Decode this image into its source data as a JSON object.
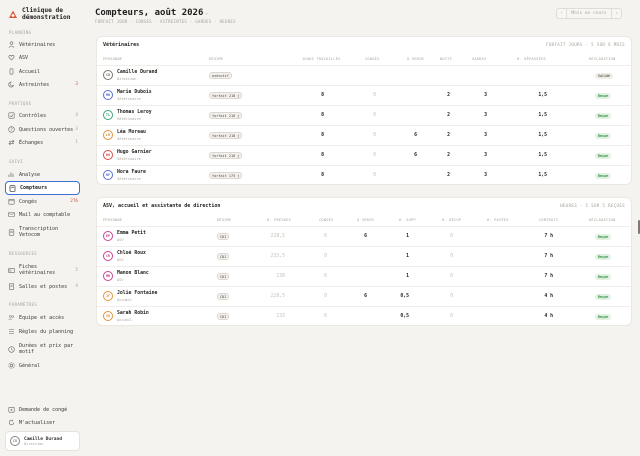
{
  "brand": {
    "name": "Clinique de démonstration"
  },
  "sections": {
    "planning": "PLANNING",
    "pratique": "PRATIQUE",
    "suivi": "SUIVI",
    "ressources": "RESSOURCES",
    "parametres": "PARAMÈTRES"
  },
  "nav": {
    "veterinaires": "Vétérinaires",
    "asv": "ASV",
    "accueil": "Accueil",
    "astreintes": "Astreintes",
    "astreintes_count": "3",
    "controles": "Contrôles",
    "controles_count": "4",
    "questions": "Questions ouvertes",
    "questions_count": "3",
    "echanges": "Échanges",
    "echanges_count": "1",
    "analyse": "Analyse",
    "compteurs": "Compteurs",
    "conges": "Congés",
    "conges_count": "276",
    "mail": "Mail au comptable",
    "transcription": "Transcription Vetocom",
    "fiches": "Fiches vétérinaires",
    "fiches_count": "5",
    "salles": "Salles et postes",
    "salles_count": "4",
    "equipe": "Equipe et accès",
    "regles": "Règles du planning",
    "durees": "Durées et prix par motif",
    "general": "Général",
    "demande": "Demande de congé",
    "actualiser": "M'actualiser"
  },
  "user": {
    "name": "Camille Durand",
    "role": "Direction",
    "initials": "CD"
  },
  "header": {
    "title": "Compteurs, août 2026",
    "breadcrumb": "FORFAIT JOUR · CONGÉS · ASTREINTES · GARDES · HEURES",
    "btn_current": "Mois en cours"
  },
  "vets": {
    "title": "Vétérinaires",
    "meta": "FORFAIT JOURS · 5 SUR 6 MOIS",
    "headers": [
      "PERSONNE",
      "RÉGIME",
      "JOURS TRAVAILLÉS",
      "CONGÉS",
      "À VENIR",
      "NUITS",
      "GARDES",
      "H. DÉPASSÉES",
      "DÉCLARATION"
    ],
    "rows": [
      {
        "initials": "CD",
        "name": "Camille Durand",
        "role": "Direction",
        "regime": "exécutif",
        "jours": "",
        "conges": "",
        "avenir": "",
        "nuits": "",
        "gardes": "",
        "heures": "",
        "status": "Validé",
        "status_kind": "gray",
        "color": "#7a7670"
      },
      {
        "initials": "MD",
        "name": "Marie Dubois",
        "role": "Vétérinaire",
        "regime": "forfait 218 j",
        "jours": "8",
        "conges": "0",
        "avenir": "",
        "nuits": "2",
        "gardes": "3",
        "heures": "1,5",
        "status": "Reçue",
        "status_kind": "green",
        "color": "#5b6fd6"
      },
      {
        "initials": "TL",
        "name": "Thomas Leroy",
        "role": "Vétérinaire",
        "regime": "forfait 218 j",
        "jours": "8",
        "conges": "0",
        "avenir": "",
        "nuits": "2",
        "gardes": "3",
        "heures": "1,5",
        "status": "Reçue",
        "status_kind": "green",
        "color": "#3aa776"
      },
      {
        "initials": "LM",
        "name": "Léa Moreau",
        "role": "Vétérinaire",
        "regime": "forfait 218 j",
        "jours": "8",
        "conges": "0",
        "avenir": "6",
        "nuits": "2",
        "gardes": "3",
        "heures": "1,5",
        "status": "Reçue",
        "status_kind": "green",
        "color": "#e0943a"
      },
      {
        "initials": "HG",
        "name": "Hugo Garnier",
        "role": "Vétérinaire",
        "regime": "forfait 218 j",
        "jours": "8",
        "conges": "0",
        "avenir": "6",
        "nuits": "2",
        "gardes": "3",
        "heures": "1,5",
        "status": "Reçue",
        "status_kind": "green",
        "color": "#d94b4b"
      },
      {
        "initials": "NF",
        "name": "Nora Faure",
        "role": "Vétérinaire",
        "regime": "forfait 175 j",
        "jours": "8",
        "conges": "0",
        "avenir": "",
        "nuits": "2",
        "gardes": "3",
        "heures": "1,5",
        "status": "Reçue",
        "status_kind": "green",
        "color": "#5b6fd6"
      }
    ]
  },
  "asv": {
    "title": "ASV, accueil et assistante de direction",
    "meta": "HEURES · 5 SUR 5 REÇUES",
    "headers": [
      "PERSONNE",
      "RÉGIME",
      "H. PRÉVUES",
      "CONGÉS",
      "À VENIR",
      "H. SUPP",
      "H. RÉCUP",
      "H. PAYÉES",
      "CONTRATS",
      "DÉCLARATION"
    ],
    "rows": [
      {
        "initials": "EP",
        "name": "Emma Petit",
        "role": "ASV",
        "regime": "CDI",
        "prevues": "228,5",
        "conges": "0",
        "avenir": "6",
        "supp": "1",
        "recup": "0",
        "payees": "",
        "contrats": "7 h",
        "status": "Reçue",
        "color": "#c9448f"
      },
      {
        "initials": "CR",
        "name": "Chloé Roux",
        "role": "ASV",
        "regime": "CDI",
        "prevues": "233,5",
        "conges": "0",
        "avenir": "",
        "supp": "1",
        "recup": "0",
        "payees": "",
        "contrats": "7 h",
        "status": "Reçue",
        "color": "#c9448f"
      },
      {
        "initials": "MB",
        "name": "Manon Blanc",
        "role": "ASV",
        "regime": "CDI",
        "prevues": "238",
        "conges": "0",
        "avenir": "",
        "supp": "1",
        "recup": "0",
        "payees": "",
        "contrats": "7 h",
        "status": "Reçue",
        "color": "#c9448f"
      },
      {
        "initials": "JF",
        "name": "Jolie Fontaine",
        "role": "Accueil",
        "regime": "CDI",
        "prevues": "228,5",
        "conges": "0",
        "avenir": "6",
        "supp": "0,5",
        "recup": "0",
        "payees": "",
        "contrats": "4 h",
        "status": "Reçue",
        "color": "#e0943a"
      },
      {
        "initials": "SR",
        "name": "Sarah Robin",
        "role": "Accueil",
        "regime": "CDI",
        "prevues": "233",
        "conges": "0",
        "avenir": "",
        "supp": "0,5",
        "recup": "0",
        "payees": "",
        "contrats": "4 h",
        "status": "Reçue",
        "color": "#e0943a"
      }
    ]
  }
}
